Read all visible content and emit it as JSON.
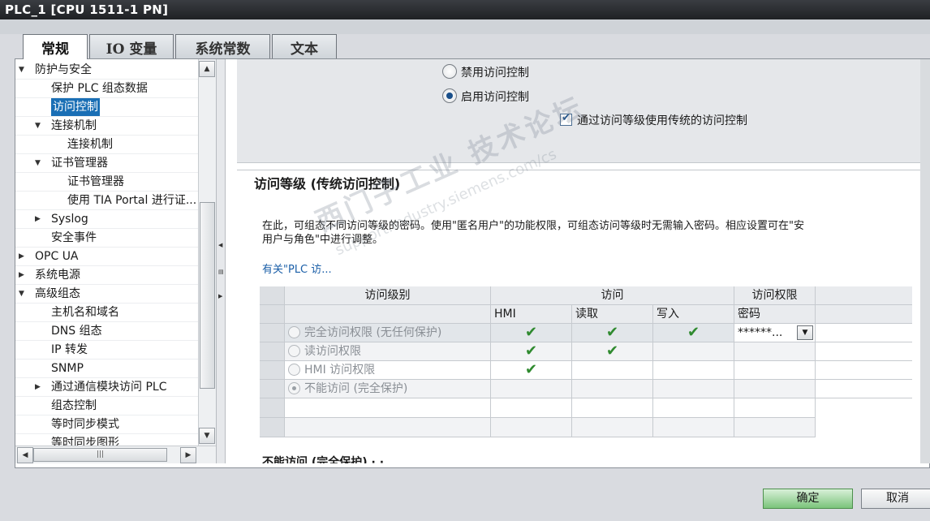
{
  "window": {
    "title": "PLC_1 [CPU 1511-1 PN]"
  },
  "tabs": [
    {
      "label": "常规",
      "active": true
    },
    {
      "label": "IO 变量",
      "active": false
    },
    {
      "label": "系统常数",
      "active": false
    },
    {
      "label": "文本",
      "active": false
    }
  ],
  "tree": {
    "items": [
      {
        "label": "防护与安全",
        "expand": "▼",
        "level": 0
      },
      {
        "label": "保护 PLC 组态数据",
        "expand": "",
        "level": 1
      },
      {
        "label": "访问控制",
        "expand": "",
        "level": 1,
        "selected": true
      },
      {
        "label": "连接机制",
        "expand": "▼",
        "level": 1
      },
      {
        "label": "连接机制",
        "expand": "",
        "level": 2
      },
      {
        "label": "证书管理器",
        "expand": "▼",
        "level": 1
      },
      {
        "label": "证书管理器",
        "expand": "",
        "level": 2
      },
      {
        "label": "使用 TIA Portal 进行证...",
        "expand": "",
        "level": 2
      },
      {
        "label": "Syslog",
        "expand": "▶",
        "level": 1
      },
      {
        "label": "安全事件",
        "expand": "",
        "level": 1
      },
      {
        "label": "OPC UA",
        "expand": "▶",
        "level": 0
      },
      {
        "label": "系统电源",
        "expand": "▶",
        "level": 0
      },
      {
        "label": "高级组态",
        "expand": "▼",
        "level": 0
      },
      {
        "label": "主机名和域名",
        "expand": "",
        "level": 1
      },
      {
        "label": "DNS 组态",
        "expand": "",
        "level": 1
      },
      {
        "label": "IP 转发",
        "expand": "",
        "level": 1
      },
      {
        "label": "SNMP",
        "expand": "",
        "level": 1
      },
      {
        "label": "通过通信模块访问 PLC",
        "expand": "▶",
        "level": 1
      },
      {
        "label": "组态控制",
        "expand": "",
        "level": 1
      },
      {
        "label": "等时同步模式",
        "expand": "",
        "level": 1
      },
      {
        "label": "等时同步图形",
        "expand": "",
        "level": 1
      }
    ]
  },
  "access": {
    "radio_disable": "禁用访问控制",
    "radio_enable": "启用访问控制",
    "checkbox_legacy": "通过访问等级使用传统的访问控制"
  },
  "levels": {
    "title": "访问等级 (传统访问控制)",
    "desc_line1": "在此，可组态不同访问等级的密码。使用\"匿名用户\"的功能权限，可组态访问等级时无需输入密码。相应设置可在\"安",
    "desc_line2": "用户与角色\"中进行调整。",
    "link": "有关\"PLC 访...",
    "table": {
      "col_level": "访问级别",
      "col_access": "访问",
      "col_rights": "访问权限",
      "sub_hmi": "HMI",
      "sub_read": "读取",
      "sub_write": "写入",
      "sub_password": "密码",
      "rows": [
        {
          "label": "完全访问权限 (无任何保护)",
          "hmi": "✔",
          "read": "✔",
          "write": "✔",
          "password": "******..."
        },
        {
          "label": "读访问权限",
          "hmi": "✔",
          "read": "✔",
          "write": "",
          "password": ""
        },
        {
          "label": "HMI 访问权限",
          "hmi": "✔",
          "read": "",
          "write": "",
          "password": ""
        },
        {
          "label": "不能访问 (完全保护)",
          "hmi": "",
          "read": "",
          "write": "",
          "password": ""
        }
      ]
    },
    "bottom_heading": "不能访问 (完全保护) · ·"
  },
  "watermark": {
    "line1": "西门子工业 技术论坛",
    "line2": "support.industry.siemens.com/cs"
  },
  "footer": {
    "ok": "确定",
    "cancel": "取消"
  }
}
